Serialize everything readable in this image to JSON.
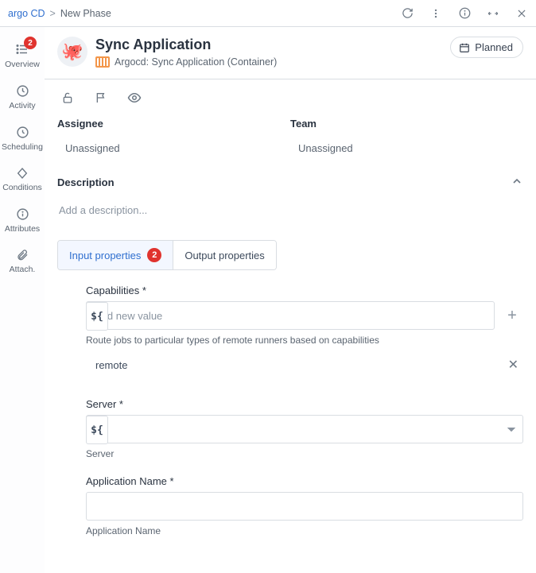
{
  "breadcrumb": {
    "parent": "argo CD",
    "current": "New Phase"
  },
  "header": {
    "title": "Sync Application",
    "subtitle": "Argocd: Sync Application (Container)",
    "status_label": "Planned"
  },
  "sidebar": {
    "items": [
      {
        "label": "Overview",
        "badge": "2"
      },
      {
        "label": "Activity"
      },
      {
        "label": "Scheduling"
      },
      {
        "label": "Conditions"
      },
      {
        "label": "Attributes"
      },
      {
        "label": "Attach."
      }
    ]
  },
  "details": {
    "assignee_label": "Assignee",
    "assignee_value": "Unassigned",
    "team_label": "Team",
    "team_value": "Unassigned",
    "description_label": "Description",
    "description_placeholder": "Add a description..."
  },
  "tabs": {
    "input": {
      "label": "Input properties",
      "badge": "2"
    },
    "output": {
      "label": "Output properties"
    }
  },
  "form": {
    "capabilities": {
      "label": "Capabilities *",
      "placeholder": "Add new value",
      "hint": "Route jobs to particular types of remote runners based on capabilities",
      "values": [
        "remote"
      ]
    },
    "server": {
      "label": "Server *",
      "hint": "Server"
    },
    "app_name": {
      "label": "Application Name *",
      "hint": "Application Name"
    }
  },
  "var_glyph": "${"
}
